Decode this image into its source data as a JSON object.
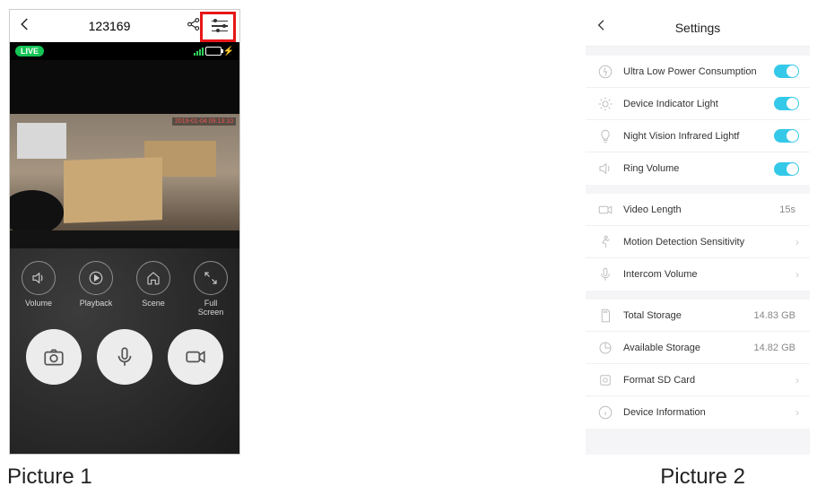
{
  "picture1": {
    "header": {
      "title": "123169"
    },
    "status": {
      "live_label": "LIVE"
    },
    "video": {
      "timestamp": "2019-01-04 09:13:10"
    },
    "small_buttons": [
      {
        "name": "volume",
        "label": "Volume"
      },
      {
        "name": "playback",
        "label": "Playback"
      },
      {
        "name": "scene",
        "label": "Scene"
      },
      {
        "name": "fullscreen",
        "label": "Full Screen"
      }
    ],
    "big_buttons": [
      {
        "name": "snapshot"
      },
      {
        "name": "mic"
      },
      {
        "name": "record"
      }
    ],
    "caption": "Picture 1"
  },
  "picture2": {
    "header": {
      "title": "Settings"
    },
    "group1": [
      {
        "icon": "bolt-circle",
        "label": "Ultra Low Power Consumption",
        "toggle": true
      },
      {
        "icon": "light",
        "label": "Device Indicator Light",
        "toggle": true
      },
      {
        "icon": "bulb",
        "label": "Night Vision Infrared Lightf",
        "toggle": true
      },
      {
        "icon": "speaker",
        "label": "Ring Volume",
        "toggle": true
      }
    ],
    "group2": [
      {
        "icon": "video",
        "label": "Video Length",
        "value": "15s"
      },
      {
        "icon": "motion",
        "label": "Motion Detection Sensitivity",
        "chevron": true
      },
      {
        "icon": "mic",
        "label": "Intercom Volume",
        "chevron": true
      }
    ],
    "group3": [
      {
        "icon": "sd",
        "label": "Total Storage",
        "value": "14.83 GB"
      },
      {
        "icon": "pie",
        "label": "Available Storage",
        "value": "14.82 GB"
      },
      {
        "icon": "format",
        "label": "Format SD Card",
        "chevron": true
      },
      {
        "icon": "info",
        "label": "Device Information",
        "chevron": true
      }
    ],
    "caption": "Picture 2"
  }
}
